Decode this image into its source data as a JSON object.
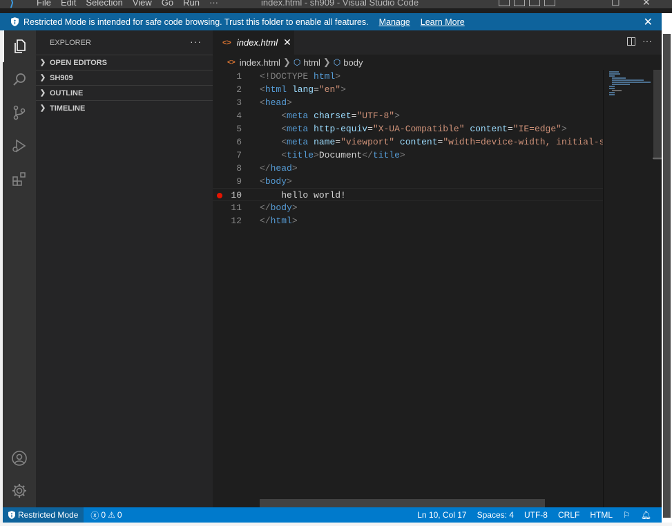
{
  "titlebar": {
    "menu": [
      "File",
      "Edit",
      "Selection",
      "View",
      "Go",
      "Run",
      "···"
    ],
    "title": "index.html - sh909 - Visual Studio Code"
  },
  "banner": {
    "message": "Restricted Mode is intended for safe code browsing. Trust this folder to enable all features.",
    "manage": "Manage",
    "learn_more": "Learn More",
    "close": "✕"
  },
  "activity_bar": {
    "items": [
      "explorer-icon",
      "search-icon",
      "source-control-icon",
      "run-debug-icon",
      "extensions-icon"
    ],
    "bottom": [
      "accounts-icon",
      "settings-gear-icon"
    ]
  },
  "sidebar": {
    "title": "EXPLORER",
    "more": "···",
    "sections": [
      "OPEN EDITORS",
      "SH909",
      "OUTLINE",
      "TIMELINE"
    ]
  },
  "tabs": [
    {
      "icon": "<>",
      "label": "index.html",
      "close": "✕"
    }
  ],
  "breadcrumb": {
    "file_icon": "<>",
    "file": "index.html",
    "items": [
      "html",
      "body"
    ]
  },
  "code": {
    "current_line": 10,
    "breakpoint_line": 10,
    "lines": [
      {
        "n": "1"
      },
      {
        "n": "2"
      },
      {
        "n": "3"
      },
      {
        "n": "4"
      },
      {
        "n": "5"
      },
      {
        "n": "6"
      },
      {
        "n": "7"
      },
      {
        "n": "8"
      },
      {
        "n": "9"
      },
      {
        "n": "10"
      },
      {
        "n": "11"
      },
      {
        "n": "12"
      }
    ],
    "tokens": {
      "doctype": "<!DOCTYPE",
      "html_word": "html",
      "lang_attr": "lang",
      "lang_val": "\"en\"",
      "head": "head",
      "meta": "meta",
      "charset_attr": "charset",
      "charset_val": "\"UTF-8\"",
      "http_equiv_attr": "http-equiv",
      "http_equiv_val": "\"X-UA-Compatible\"",
      "content_attr": "content",
      "content_val": "\"IE=edge\"",
      "name_attr": "name",
      "name_val": "\"viewport\"",
      "content_val2": "\"width=device-width, initial-sc",
      "title": "title",
      "title_text": "Document",
      "body": "body",
      "hello": "hello world!"
    }
  },
  "statusbar": {
    "restricted": "Restricted Mode",
    "errors": "0",
    "warnings": "0",
    "position": "Ln 10, Col 17",
    "spaces": "Spaces: 4",
    "encoding": "UTF-8",
    "eol": "CRLF",
    "language": "HTML"
  },
  "colors": {
    "accent": "#007acc",
    "banner": "#0e639c",
    "breakpoint": "#e51400"
  }
}
